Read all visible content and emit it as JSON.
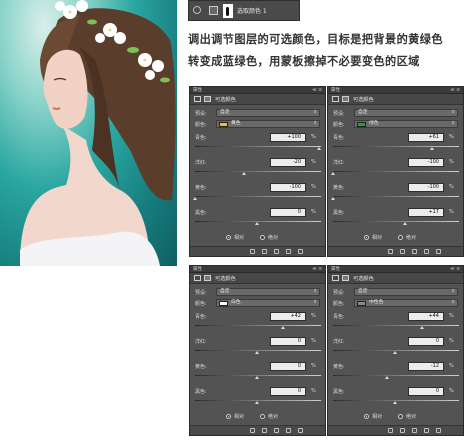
{
  "layer": {
    "name": "选取颜色 1"
  },
  "instruction": {
    "line1": "调出调节图层的可选颜色，目标是把背景的黄绿色",
    "line2": "转变成蓝绿色，用蒙板擦掉不必要变色的区域"
  },
  "colors": {
    "panel_bg": "#535353",
    "input_bg": "#ececec"
  },
  "panels": [
    {
      "tab_label": "属性",
      "tab_ctrl": "≪ ≡",
      "title": "可选颜色",
      "preset_label": "预设:",
      "preset_value": "自定",
      "colors_label": "颜色:",
      "color_name": "黄色",
      "swatch_color": "#e9c62a",
      "rows": [
        {
          "label": "青色:",
          "value": "+100",
          "fraction": 1.0
        },
        {
          "label": "洋红:",
          "value": "-20",
          "fraction": 0.4
        },
        {
          "label": "黄色:",
          "value": "-100",
          "fraction": 0.0
        },
        {
          "label": "黑色:",
          "value": "0",
          "fraction": 0.5
        }
      ],
      "radio_relative": "相对",
      "radio_absolute": "绝对"
    },
    {
      "tab_label": "属性",
      "tab_ctrl": "≪ ≡",
      "title": "可选颜色",
      "preset_label": "预设:",
      "preset_value": "自定",
      "colors_label": "颜色:",
      "color_name": "绿色",
      "swatch_color": "#2f9a3a",
      "rows": [
        {
          "label": "青色:",
          "value": "+61",
          "fraction": 0.805
        },
        {
          "label": "洋红:",
          "value": "-100",
          "fraction": 0.0
        },
        {
          "label": "黄色:",
          "value": "-100",
          "fraction": 0.0
        },
        {
          "label": "黑色:",
          "value": "+17",
          "fraction": 0.585
        }
      ],
      "radio_relative": "相对",
      "radio_absolute": "绝对"
    },
    {
      "tab_label": "属性",
      "tab_ctrl": "≪ ≡",
      "title": "可选颜色",
      "preset_label": "预设:",
      "preset_value": "自定",
      "colors_label": "颜色:",
      "color_name": "白色",
      "swatch_color": "#ffffff",
      "rows": [
        {
          "label": "青色:",
          "value": "+42",
          "fraction": 0.71
        },
        {
          "label": "洋红:",
          "value": "0",
          "fraction": 0.5
        },
        {
          "label": "黄色:",
          "value": "0",
          "fraction": 0.5
        },
        {
          "label": "黑色:",
          "value": "0",
          "fraction": 0.5
        }
      ],
      "radio_relative": "相对",
      "radio_absolute": "绝对"
    },
    {
      "tab_label": "属性",
      "tab_ctrl": "≪ ≡",
      "title": "可选颜色",
      "preset_label": "预设:",
      "preset_value": "自定",
      "colors_label": "颜色:",
      "color_name": "中性色",
      "swatch_color": "#8a8a8a",
      "rows": [
        {
          "label": "青色:",
          "value": "+44",
          "fraction": 0.72
        },
        {
          "label": "洋红:",
          "value": "0",
          "fraction": 0.5
        },
        {
          "label": "黄色:",
          "value": "-12",
          "fraction": 0.44
        },
        {
          "label": "黑色:",
          "value": "0",
          "fraction": 0.5
        }
      ],
      "radio_relative": "相对",
      "radio_absolute": "绝对"
    }
  ]
}
